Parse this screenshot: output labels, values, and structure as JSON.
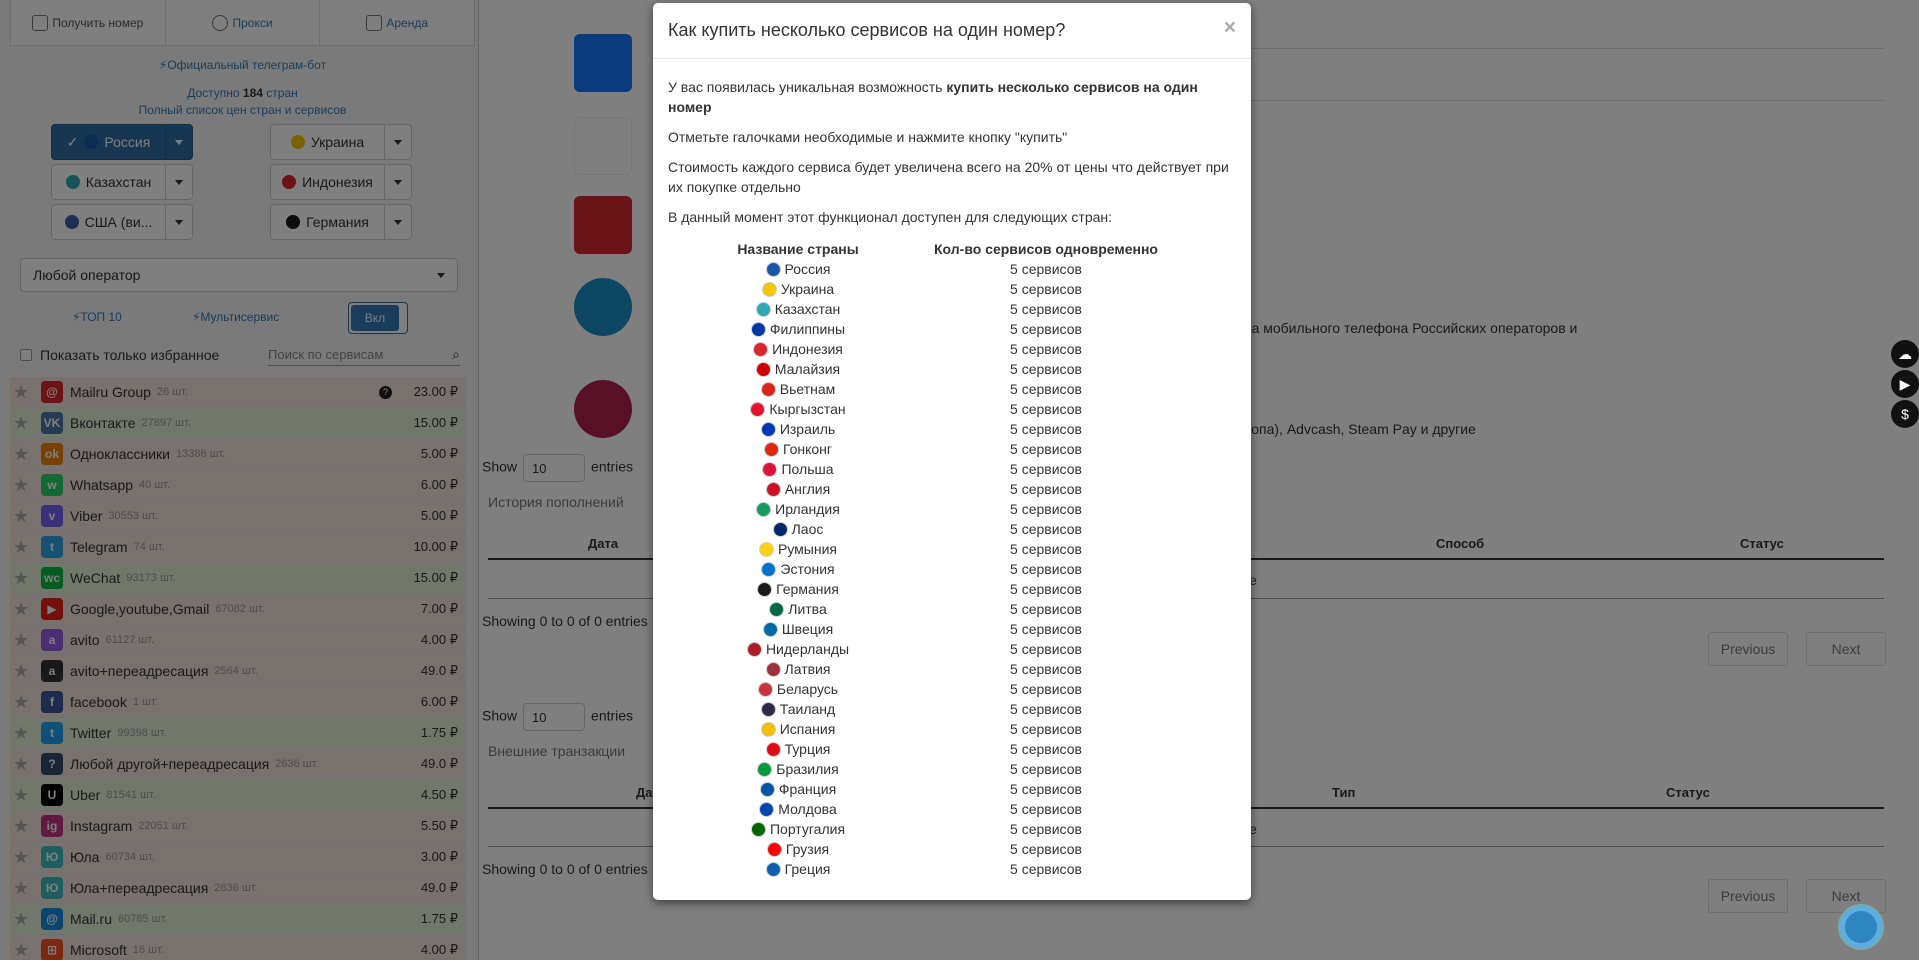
{
  "topnav": [
    {
      "label": "Получить номер",
      "icon": "phone-icon",
      "link": false
    },
    {
      "label": "Прокси",
      "icon": "cloud-icon",
      "link": true
    },
    {
      "label": "Аренда",
      "icon": "building-icon",
      "link": true
    }
  ],
  "sidebar": {
    "telegram_bot": "⚡Официальный телеграм-бот",
    "available_prefix": "Доступно ",
    "available_count": "184",
    "available_suffix": " стран",
    "full_list": "Полный список цен стран и сервисов",
    "countries": [
      {
        "label": "Россия",
        "flag_color": "#1c57a5",
        "active": true
      },
      {
        "label": "Украина",
        "flag_color": "#f2c600",
        "active": false
      },
      {
        "label": "Казахстан",
        "flag_color": "#2fa8b5",
        "active": false
      },
      {
        "label": "Индонезия",
        "flag_color": "#d9262e",
        "active": false
      },
      {
        "label": "США (ви...",
        "flag_color": "#3c5da7",
        "active": false
      },
      {
        "label": "Германия",
        "flag_color": "#1a1a1a",
        "active": false
      }
    ],
    "operator_select": "Любой оператор",
    "top10": "⚡ТОП 10",
    "multiservice": "⚡Мультисервис",
    "toggle_on": "Вкл",
    "favorites_label": "Показать только избранное",
    "search_placeholder": "Поиск по сервисам",
    "services": [
      {
        "name": "Mailru Group",
        "count": "26 шт.",
        "price": "23.00 ₽",
        "color": "#d9262e",
        "glyph": "@",
        "bg": "pink",
        "help": true
      },
      {
        "name": "Вконтакте",
        "count": "27897 шт.",
        "price": "15.00 ₽",
        "color": "#4a76a8",
        "glyph": "VK",
        "bg": "green"
      },
      {
        "name": "Одноклассники",
        "count": "13386 шт.",
        "price": "5.00 ₽",
        "color": "#ee8208",
        "glyph": "ok",
        "bg": "pink"
      },
      {
        "name": "Whatsapp",
        "count": "40 шт.",
        "price": "6.00 ₽",
        "color": "#25d366",
        "glyph": "w",
        "bg": "pink"
      },
      {
        "name": "Viber",
        "count": "30553 шт.",
        "price": "5.00 ₽",
        "color": "#7360f2",
        "glyph": "v",
        "bg": "pink"
      },
      {
        "name": "Telegram",
        "count": "74 шт.",
        "price": "10.00 ₽",
        "color": "#2ca5e0",
        "glyph": "t",
        "bg": "pink"
      },
      {
        "name": "WeChat",
        "count": "93173 шт.",
        "price": "15.00 ₽",
        "color": "#09b83e",
        "glyph": "wc",
        "bg": "green"
      },
      {
        "name": "Google,youtube,Gmail",
        "count": "67082 шт.",
        "price": "7.00 ₽",
        "color": "#e62117",
        "glyph": "▶",
        "bg": "pink"
      },
      {
        "name": "avito",
        "count": "61127 шт.",
        "price": "4.00 ₽",
        "color": "#965eeb",
        "glyph": "a",
        "bg": "pink"
      },
      {
        "name": "avito+переадресация",
        "count": "2564 шт.",
        "price": "49.0 ₽",
        "color": "#333333",
        "glyph": "a",
        "bg": "pink"
      },
      {
        "name": "facebook",
        "count": "1 шт.",
        "price": "6.00 ₽",
        "color": "#3b5998",
        "glyph": "f",
        "bg": "pink"
      },
      {
        "name": "Twitter",
        "count": "99398 шт.",
        "price": "1.75 ₽",
        "color": "#1da1f2",
        "glyph": "t",
        "bg": "green"
      },
      {
        "name": "Любой другой+переадресация",
        "count": "2636 шт.",
        "price": "49.0 ₽",
        "color": "#2e4a6b",
        "glyph": "?",
        "bg": "pink"
      },
      {
        "name": "Uber",
        "count": "81541 шт.",
        "price": "4.50 ₽",
        "color": "#000000",
        "glyph": "U",
        "bg": "green"
      },
      {
        "name": "Instagram",
        "count": "22051 шт.",
        "price": "5.50 ₽",
        "color": "#c13584",
        "glyph": "ig",
        "bg": "pink"
      },
      {
        "name": "Юла",
        "count": "60734 шт.",
        "price": "3.00 ₽",
        "color": "#3dbbc1",
        "glyph": "Ю",
        "bg": "pink"
      },
      {
        "name": "Юла+переадресация",
        "count": "2636 шт.",
        "price": "49.0 ₽",
        "color": "#3dbbc1",
        "glyph": "Ю",
        "bg": "pink"
      },
      {
        "name": "Mail.ru",
        "count": "60785 шт.",
        "price": "1.75 ₽",
        "color": "#168de2",
        "glyph": "@",
        "bg": "green"
      },
      {
        "name": "Microsoft",
        "count": "16 шт.",
        "price": "4.00 ₽",
        "color": "#f25022",
        "glyph": "⊞",
        "bg": "pink"
      }
    ]
  },
  "content": {
    "payment_text_1": "ера мобильного телефона Российских операторов и",
    "payment_text_2": "вропа), Advcash, Steam Pay и другие",
    "table1": {
      "show": "Show",
      "entries_value": "10",
      "entries": "entries",
      "title": "История пополнений",
      "headers": [
        "Дата",
        "Способ",
        "Статус"
      ],
      "empty_fragment": "le",
      "info": "Showing 0 to 0 of 0 entries",
      "previous": "Previous",
      "next": "Next"
    },
    "table2": {
      "show": "Show",
      "entries_value": "10",
      "entries": "entries",
      "title": "Внешние транзакции",
      "headers": [
        "Дат",
        "Тип",
        "Статус"
      ],
      "empty_fragment": "le",
      "info": "Showing 0 to 0 of 0 entries",
      "previous": "Previous",
      "next": "Next"
    }
  },
  "modal": {
    "title": "Как купить несколько сервисов на один номер?",
    "close": "×",
    "p1_prefix": "У вас появилась уникальная возможность ",
    "p1_bold": "купить несколько сервисов на один номер",
    "p2": "Отметьте галочками необходимые и нажмите кнопку \"купить\"",
    "p3": "Стоимость каждого сервиса будет увеличена всего на 20% от цены что действует при их покупке отдельно",
    "p4": "В данный момент этот функционал доступен для следующих стран:",
    "col1": "Название страны",
    "col2": "Кол-во сервисов одновременно",
    "rows": [
      {
        "country": "Россия",
        "count": "5 сервисов",
        "flag": "#1c57a5"
      },
      {
        "country": "Украина",
        "count": "5 сервисов",
        "flag": "#f2c600"
      },
      {
        "country": "Казахстан",
        "count": "5 сервисов",
        "flag": "#2fa8b5"
      },
      {
        "country": "Филиппины",
        "count": "5 сервисов",
        "flag": "#0038a8"
      },
      {
        "country": "Индонезия",
        "count": "5 сервисов",
        "flag": "#d9262e"
      },
      {
        "country": "Малайзия",
        "count": "5 сервисов",
        "flag": "#cc0001"
      },
      {
        "country": "Вьетнам",
        "count": "5 сервисов",
        "flag": "#da251d"
      },
      {
        "country": "Кыргызстан",
        "count": "5 сервисов",
        "flag": "#e8112d"
      },
      {
        "country": "Израиль",
        "count": "5 сервисов",
        "flag": "#0038b8"
      },
      {
        "country": "Гонконг",
        "count": "5 сервисов",
        "flag": "#de2910"
      },
      {
        "country": "Польша",
        "count": "5 сервисов",
        "flag": "#dc143c"
      },
      {
        "country": "Англия",
        "count": "5 сервисов",
        "flag": "#ce1124"
      },
      {
        "country": "Ирландия",
        "count": "5 сервисов",
        "flag": "#169b62"
      },
      {
        "country": "Лаос",
        "count": "5 сервисов",
        "flag": "#002868"
      },
      {
        "country": "Румыния",
        "count": "5 сервисов",
        "flag": "#fcd116"
      },
      {
        "country": "Эстония",
        "count": "5 сервисов",
        "flag": "#0072ce"
      },
      {
        "country": "Германия",
        "count": "5 сервисов",
        "flag": "#1a1a1a"
      },
      {
        "country": "Литва",
        "count": "5 сервисов",
        "flag": "#006a44"
      },
      {
        "country": "Швеция",
        "count": "5 сервисов",
        "flag": "#006aa7"
      },
      {
        "country": "Нидерланды",
        "count": "5 сервисов",
        "flag": "#ae1c28"
      },
      {
        "country": "Латвия",
        "count": "5 сервисов",
        "flag": "#9e3039"
      },
      {
        "country": "Беларусь",
        "count": "5 сервисов",
        "flag": "#c8313e"
      },
      {
        "country": "Таиланд",
        "count": "5 сервисов",
        "flag": "#2d2a4a"
      },
      {
        "country": "Испания",
        "count": "5 сервисов",
        "flag": "#f1bf00"
      },
      {
        "country": "Турция",
        "count": "5 сервисов",
        "flag": "#e30a17"
      },
      {
        "country": "Бразилия",
        "count": "5 сервисов",
        "flag": "#009c3b"
      },
      {
        "country": "Франция",
        "count": "5 сервисов",
        "flag": "#0055a4"
      },
      {
        "country": "Молдова",
        "count": "5 сервисов",
        "flag": "#0046ae"
      },
      {
        "country": "Португалия",
        "count": "5 сервисов",
        "flag": "#006600"
      },
      {
        "country": "Грузия",
        "count": "5 сервисов",
        "flag": "#ff0000"
      },
      {
        "country": "Греция",
        "count": "5 сервисов",
        "flag": "#0d5eaf"
      }
    ]
  },
  "side_icons": [
    "wechat-icon",
    "youtube-icon",
    "dollar-icon"
  ]
}
